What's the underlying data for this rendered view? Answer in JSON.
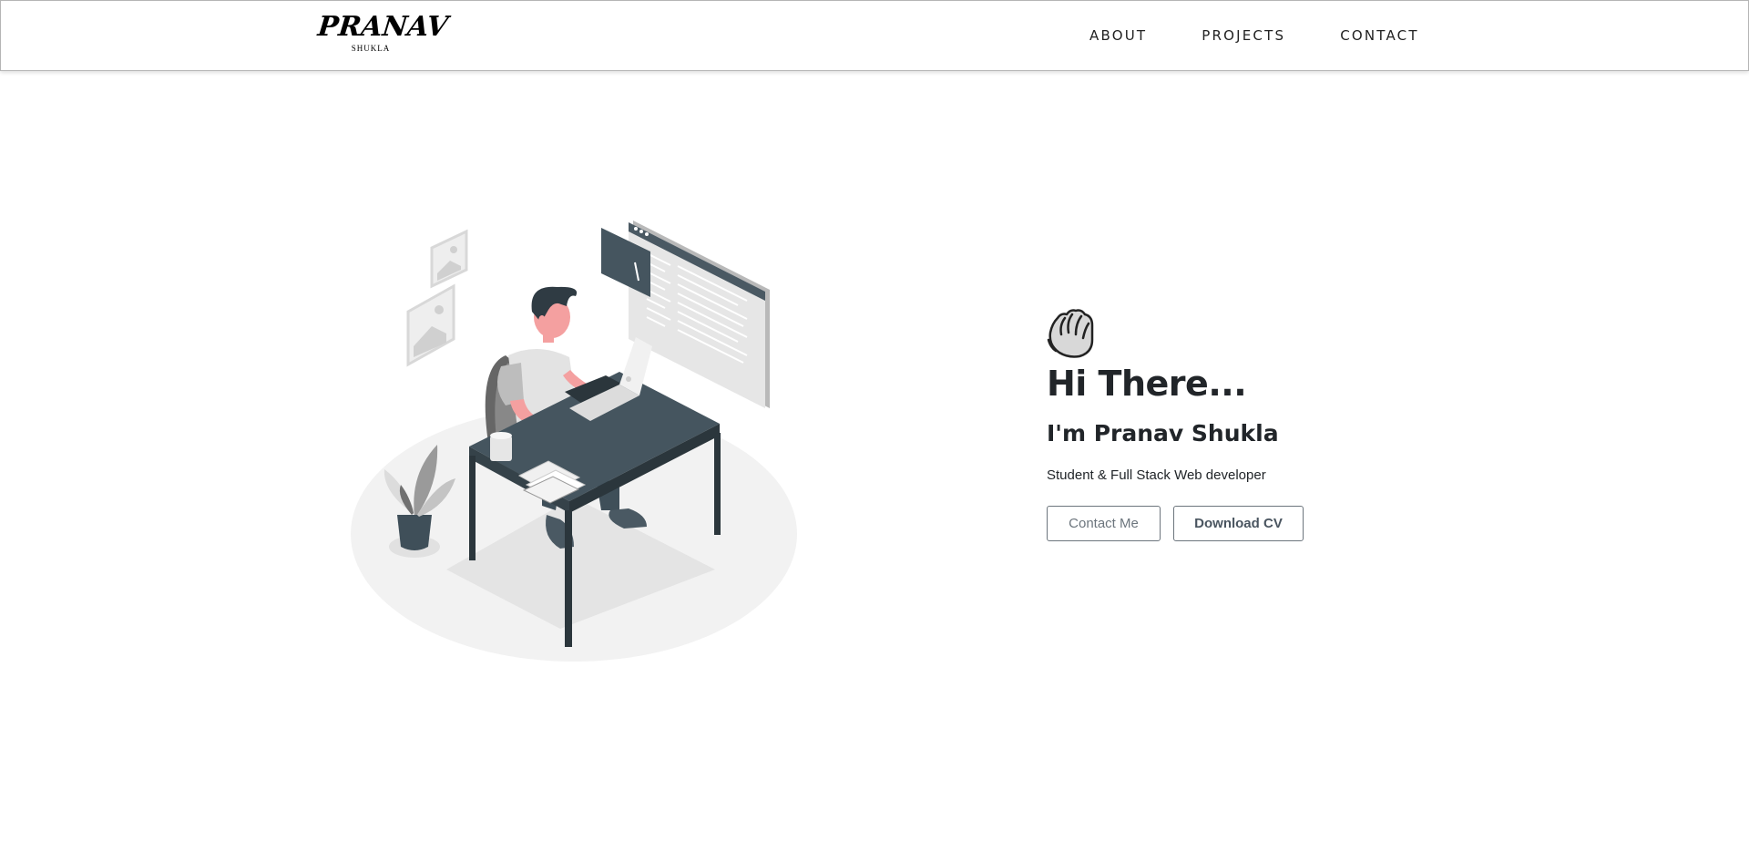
{
  "nav": {
    "brand_main": "PRANAV",
    "brand_sub": "SHUKLA",
    "links": [
      "ABOUT",
      "PROJECTS",
      "CONTACT"
    ]
  },
  "hero": {
    "icon": "waving-hand-icon",
    "greeting": "Hi There...",
    "name": "I'm Pranav Shukla",
    "tagline": "Student & Full Stack Web developer",
    "buttons": {
      "contact": "Contact Me",
      "download": "Download CV"
    }
  },
  "illustration": {
    "icon": "developer-at-desk-illustration"
  },
  "colors": {
    "text": "#212529",
    "button_border": "#6c757d",
    "illustration_dark": "#3f4f59",
    "skin": "#f4a0a0"
  }
}
